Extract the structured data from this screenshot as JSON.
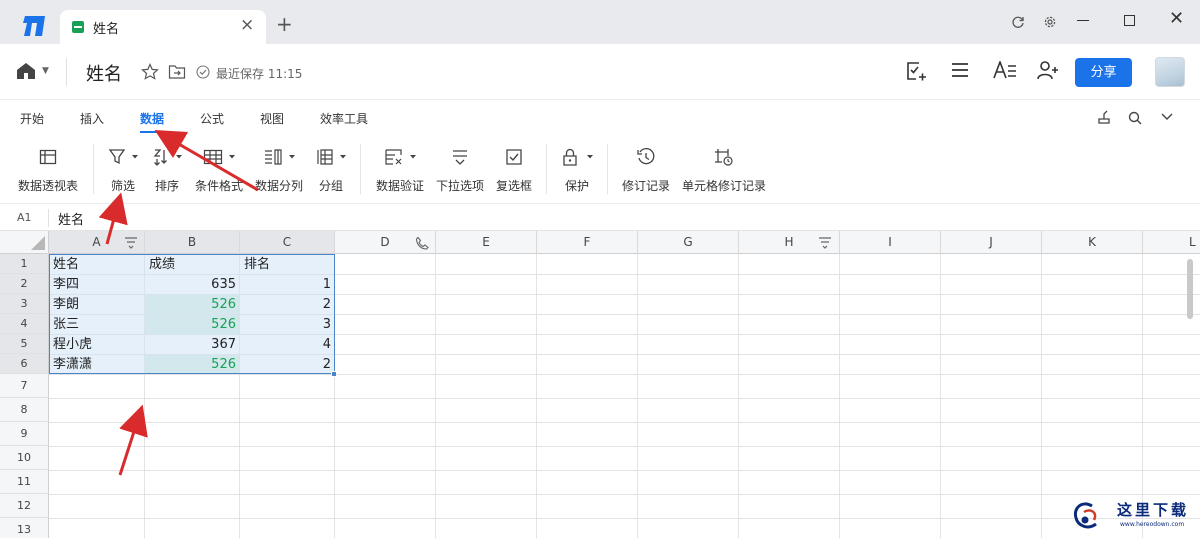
{
  "tab": {
    "title": "姓名"
  },
  "doc": {
    "title": "姓名",
    "save_status": "最近保存 11:15",
    "share_label": "分享"
  },
  "menu": [
    "开始",
    "插入",
    "数据",
    "公式",
    "视图",
    "效率工具"
  ],
  "active_menu": "数据",
  "toolbar": [
    {
      "label": "数据透视表",
      "icon": "pivot-table-icon"
    },
    {
      "label": "筛选",
      "icon": "filter-icon"
    },
    {
      "label": "排序",
      "icon": "sort-icon"
    },
    {
      "label": "条件格式",
      "icon": "conditional-format-icon"
    },
    {
      "label": "数据分列",
      "icon": "split-column-icon"
    },
    {
      "label": "分组",
      "icon": "group-icon"
    },
    {
      "label": "数据验证",
      "icon": "data-validation-icon"
    },
    {
      "label": "下拉选项",
      "icon": "dropdown-options-icon"
    },
    {
      "label": "复选框",
      "icon": "checkbox-icon"
    },
    {
      "label": "保护",
      "icon": "lock-icon"
    },
    {
      "label": "修订记录",
      "icon": "history-icon"
    },
    {
      "label": "单元格修订记录",
      "icon": "cell-history-icon"
    }
  ],
  "formula_bar": {
    "cell_ref": "A1",
    "content": "姓名"
  },
  "grid": {
    "columns": [
      "A",
      "B",
      "C",
      "D",
      "E",
      "F",
      "G",
      "H",
      "I",
      "J",
      "K",
      "L"
    ],
    "rows": [
      "1",
      "2",
      "3",
      "4",
      "5",
      "6",
      "7",
      "8",
      "9",
      "10",
      "11",
      "12",
      "13"
    ],
    "cells": [
      [
        "姓名",
        "成绩",
        "排名"
      ],
      [
        "李四",
        "635",
        "1"
      ],
      [
        "李朗",
        "526",
        "2"
      ],
      [
        "张三",
        "526",
        "3"
      ],
      [
        "程小虎",
        "367",
        "4"
      ],
      [
        "李潇潇",
        "526",
        "2"
      ]
    ],
    "highlight_color": "#18a058"
  },
  "watermark": {
    "text": "这里下载",
    "sub": "www.hereodown.com"
  },
  "colors": {
    "accent": "#1a73e8",
    "arrow": "#d92b2b"
  }
}
